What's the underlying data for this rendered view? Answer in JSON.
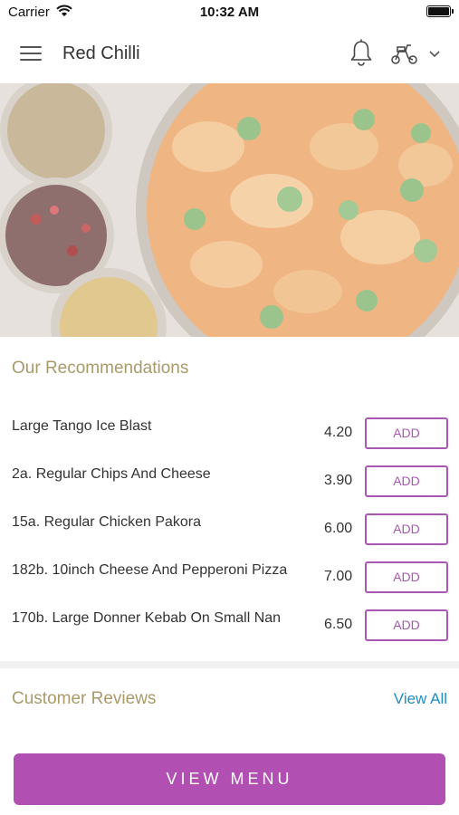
{
  "status_bar": {
    "carrier": "Carrier",
    "time": "10:32 AM"
  },
  "header": {
    "title": "Red Chilli",
    "icons": [
      "menu-icon",
      "bell-icon",
      "scooter-icon",
      "chevron-down-icon"
    ]
  },
  "hero": {
    "image": "curry-and-spices-photo"
  },
  "recommendations": {
    "title": "Our Recommendations",
    "add_label": "ADD",
    "items": [
      {
        "name": "Large Tango Ice Blast",
        "price": "4.20"
      },
      {
        "name": "2a. Regular Chips And Cheese",
        "price": "3.90"
      },
      {
        "name": "15a. Regular Chicken Pakora",
        "price": "6.00"
      },
      {
        "name": "182b. 10inch Cheese And Pepperoni Pizza",
        "price": "7.00"
      },
      {
        "name": "170b. Large Donner Kebab On Small Nan",
        "price": "6.50"
      }
    ]
  },
  "reviews": {
    "title": "Customer Reviews",
    "view_all": "View All"
  },
  "footer": {
    "view_menu": "VIEW MENU"
  },
  "colors": {
    "accent": "#b150b2",
    "section_title": "#a99a6a",
    "link": "#1f8fbf"
  }
}
